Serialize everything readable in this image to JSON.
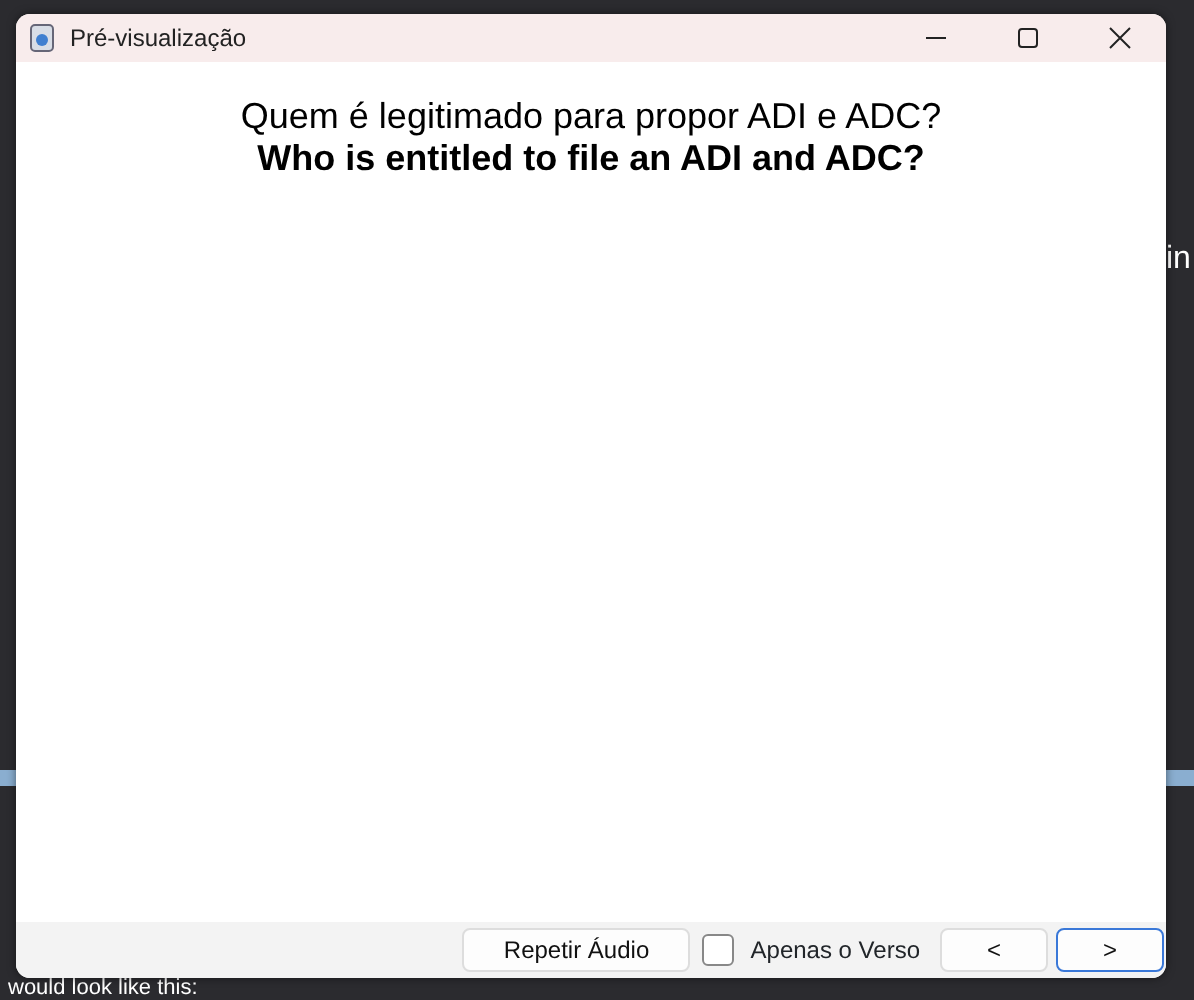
{
  "background": {
    "side_text": "in",
    "footer_text": "would look like this:"
  },
  "window": {
    "title": "Pré-visualização"
  },
  "card": {
    "front": "Quem é legitimado para propor ADI e ADC?",
    "back": "Who is entitled to file an ADI and ADC?"
  },
  "repeat_button": "Repetir Áudio",
  "back_only": {
    "label": "Apenas o Verso",
    "checked": false
  },
  "nav_buttons": [
    {
      "label": "<",
      "focused": false
    },
    {
      "label": ">",
      "focused": true
    }
  ]
}
